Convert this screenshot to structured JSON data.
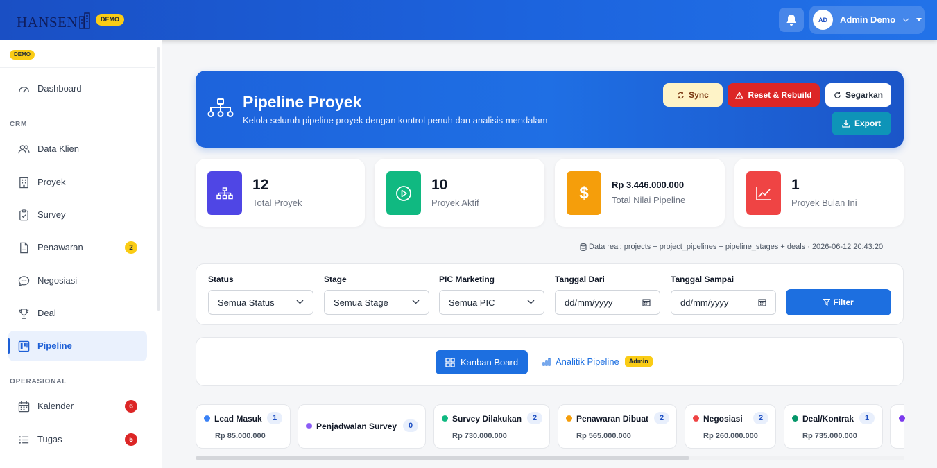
{
  "header": {
    "logo_text": "HANSEN",
    "demo_badge": "DEMO",
    "user_initials": "AD",
    "user_name": "Admin Demo"
  },
  "sidebar": {
    "demo_badge": "DEMO",
    "dashboard": "Dashboard",
    "sections": {
      "crm": "CRM",
      "operasional": "OPERASIONAL"
    },
    "items": {
      "data_klien": "Data Klien",
      "proyek": "Proyek",
      "survey": "Survey",
      "penawaran": "Penawaran",
      "negosiasi": "Negosiasi",
      "deal": "Deal",
      "pipeline": "Pipeline",
      "kalender": "Kalender",
      "tugas": "Tugas"
    },
    "badges": {
      "penawaran": "2",
      "kalender": "6",
      "tugas": "5"
    },
    "badge_colors": {
      "penawaran": "#facc15",
      "kalender": "#dc2626",
      "tugas": "#dc2626"
    }
  },
  "hero": {
    "title": "Pipeline Proyek",
    "subtitle": "Kelola seluruh pipeline proyek dengan kontrol penuh dan analisis mendalam",
    "buttons": {
      "sync": "Sync",
      "reset": "Reset & Rebuild",
      "refresh": "Segarkan",
      "export": "Export"
    }
  },
  "stats": [
    {
      "value": "12",
      "label": "Total Proyek",
      "color": "#4f46e5",
      "icon": "sitemap-icon"
    },
    {
      "value": "10",
      "label": "Proyek Aktif",
      "color": "#10b981",
      "icon": "play-circle-icon"
    },
    {
      "value": "Rp 3.446.000.000",
      "label": "Total Nilai Pipeline",
      "color": "#f59e0b",
      "icon": "dollar-icon"
    },
    {
      "value": "1",
      "label": "Proyek Bulan Ini",
      "color": "#ef4444",
      "icon": "chart-line-icon"
    }
  ],
  "data_source_note": "Data real: projects + project_pipelines + pipeline_stages + deals · 2026-06-12 20:43:20",
  "filters": {
    "status": {
      "label": "Status",
      "value": "Semua Status"
    },
    "stage": {
      "label": "Stage",
      "value": "Semua Stage"
    },
    "pic": {
      "label": "PIC Marketing",
      "value": "Semua PIC"
    },
    "date_from": {
      "label": "Tanggal Dari",
      "value": "dd/mm/yyyy"
    },
    "date_to": {
      "label": "Tanggal Sampai",
      "value": "dd/mm/yyyy"
    },
    "button": "Filter"
  },
  "views": {
    "kanban": "Kanban Board",
    "analytics": "Analitik Pipeline",
    "admin_badge": "Admin"
  },
  "stages": [
    {
      "name": "Lead Masuk",
      "count": "1",
      "amount": "Rp 85.000.000",
      "color": "#3b82f6"
    },
    {
      "name": "Penjadwalan Survey",
      "count": "0",
      "amount": "",
      "color": "#8b5cf6"
    },
    {
      "name": "Survey Dilakukan",
      "count": "2",
      "amount": "Rp 730.000.000",
      "color": "#10b981"
    },
    {
      "name": "Penawaran Dibuat",
      "count": "2",
      "amount": "Rp 565.000.000",
      "color": "#f59e0b"
    },
    {
      "name": "Negosiasi",
      "count": "2",
      "amount": "Rp 260.000.000",
      "color": "#ef4444"
    },
    {
      "name": "Deal/Kontrak",
      "count": "1",
      "amount": "Rp 735.000.000",
      "color": "#059669"
    },
    {
      "name": "",
      "count": "",
      "amount": "",
      "color": "#7c3aed"
    }
  ]
}
